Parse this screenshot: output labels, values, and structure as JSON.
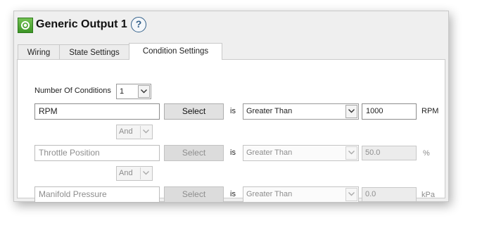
{
  "header": {
    "title": "Generic Output 1",
    "help_label": "?",
    "icon": "power-icon",
    "help_icon": "help-icon"
  },
  "tabs": [
    {
      "label": "Wiring",
      "active": false
    },
    {
      "label": "State Settings",
      "active": false
    },
    {
      "label": "Condition Settings",
      "active": true
    }
  ],
  "num_conditions": {
    "label": "Number Of Conditions",
    "value": "1"
  },
  "conditions": [
    {
      "channel": "RPM",
      "select_label": "Select",
      "is_label": "is",
      "operator": "Greater Than",
      "value": "1000",
      "unit": "RPM",
      "enabled": true
    },
    {
      "channel": "Throttle Position",
      "select_label": "Select",
      "is_label": "is",
      "operator": "Greater Than",
      "value": "50.0",
      "unit": "%",
      "enabled": false
    },
    {
      "channel": "Manifold Pressure",
      "select_label": "Select",
      "is_label": "is",
      "operator": "Greater Than",
      "value": "0.0",
      "unit": "kPa",
      "enabled": false
    }
  ],
  "connectors": [
    {
      "value": "And"
    },
    {
      "value": "And"
    }
  ],
  "colors": {
    "accent_green": "#4caf2e",
    "help_blue": "#33608a"
  }
}
